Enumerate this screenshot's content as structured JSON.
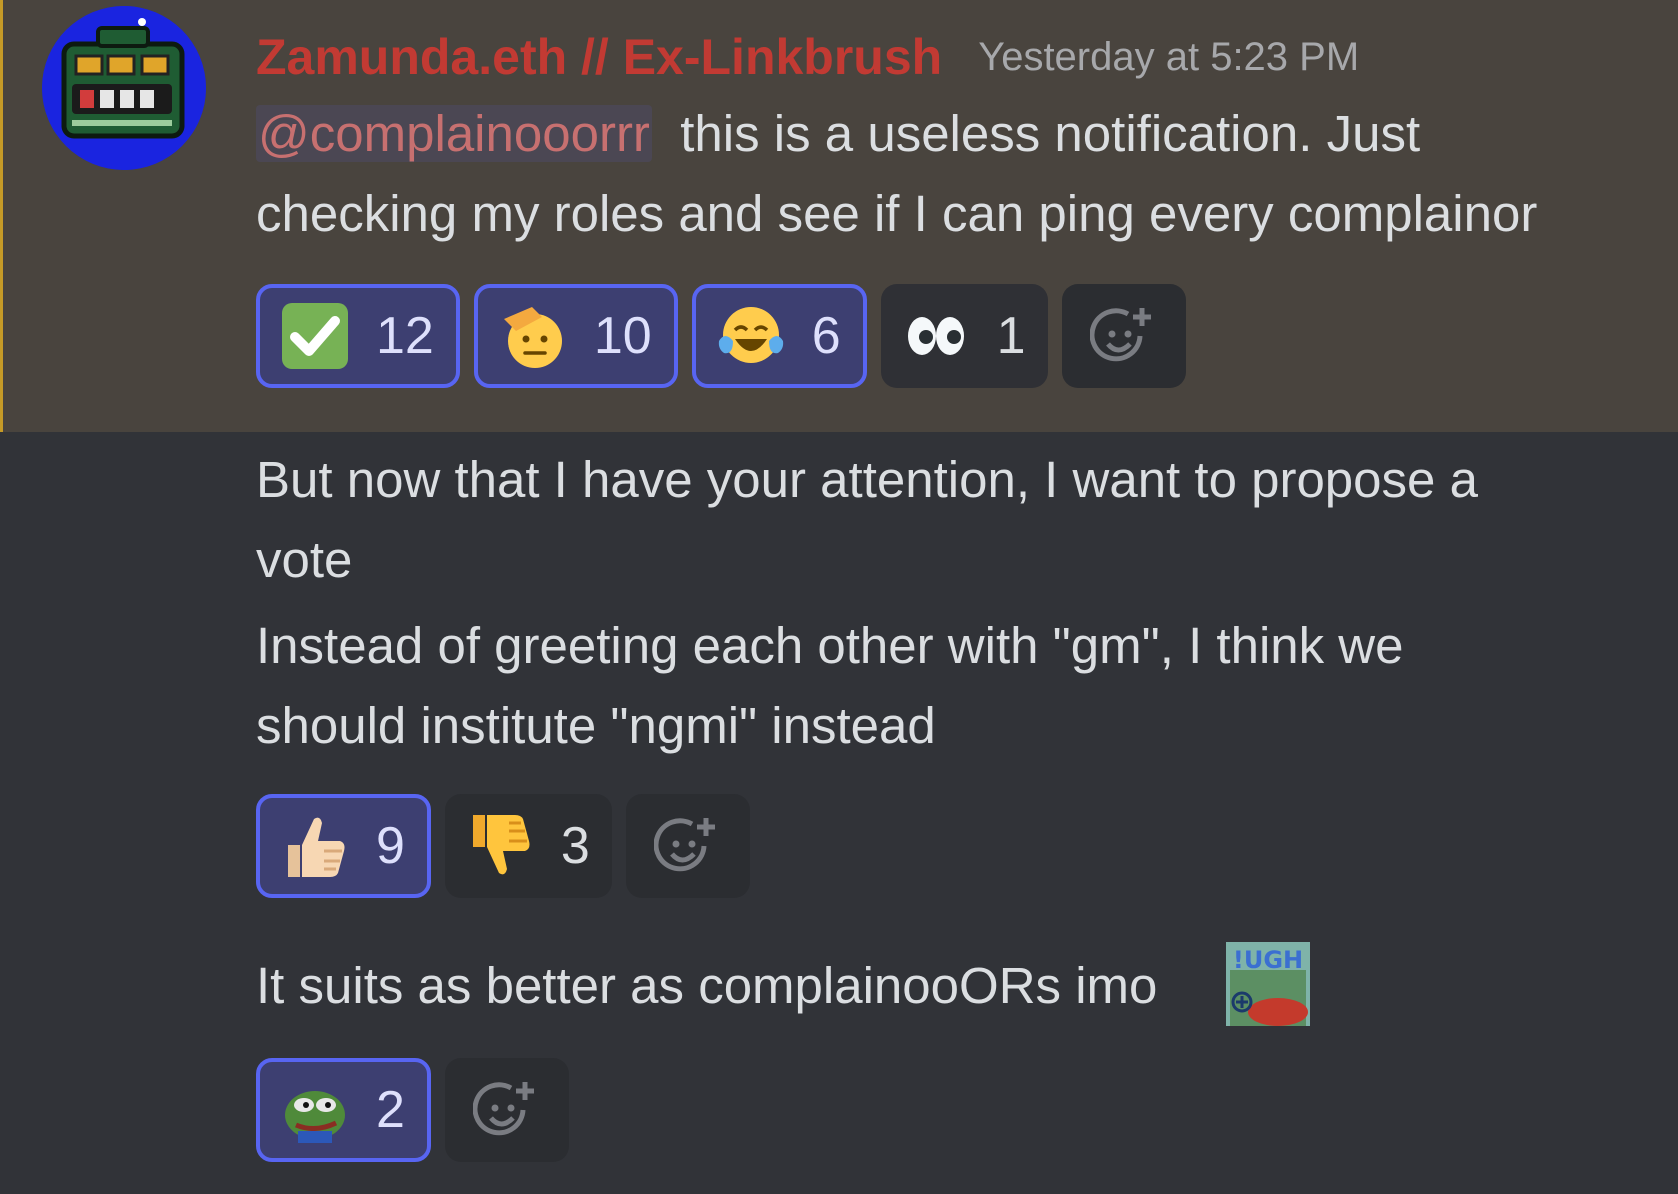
{
  "message": {
    "username": "Zamunda.eth // Ex-Linkbrush",
    "timestamp": "Yesterday at 5:23 PM",
    "mention": "@complainooorrr",
    "line1_rest": "this is a useless notification. Just",
    "line2": "checking my roles and see if I can ping every complainor",
    "reactions": [
      {
        "emoji": "check-mark-emoji",
        "count": "12",
        "reacted": true
      },
      {
        "emoji": "saluting-face-emoji",
        "count": "10",
        "reacted": true
      },
      {
        "emoji": "tears-of-joy-emoji",
        "count": "6",
        "reacted": true
      },
      {
        "emoji": "eyes-emoji",
        "count": "1",
        "reacted": false
      }
    ]
  },
  "followup1": {
    "lines": [
      "But now that I have your attention, I want to propose a",
      "vote",
      "Instead of greeting each other with \"gm\", I think we",
      "should institute \"ngmi\" instead"
    ],
    "reactions": [
      {
        "emoji": "thumbs-up-emoji",
        "count": "9",
        "reacted": true
      },
      {
        "emoji": "thumbs-down-emoji",
        "count": "3",
        "reacted": false
      }
    ]
  },
  "followup2": {
    "text": "It suits as better as complainooORs imo",
    "inline_emoji_text": "!UGH",
    "reactions": [
      {
        "emoji": "pepe-frog-emoji",
        "count": "2",
        "reacted": true
      }
    ]
  },
  "colors": {
    "background": "#313338",
    "highlight": "#49443e",
    "username": "#c23a33",
    "mention": "#c77070",
    "reaction_active_border": "#5865f2"
  }
}
